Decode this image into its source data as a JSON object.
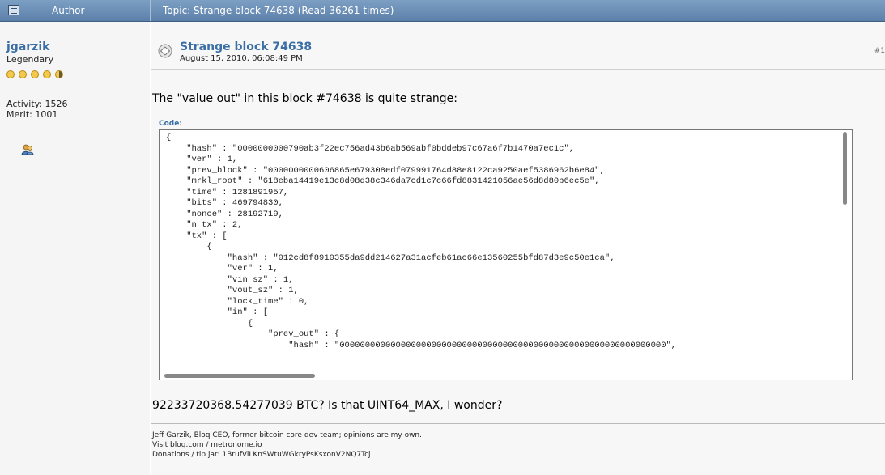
{
  "header": {
    "author_label": "Author",
    "topic_label": "Topic: Strange block 74638  (Read 36261 times)"
  },
  "poster": {
    "name": "jgarzik",
    "rank": "Legendary",
    "activity": "Activity: 1526",
    "merit": "Merit: 1001",
    "icons": {
      "rank_coins": "coin-icon",
      "profile": "user-icon"
    }
  },
  "post": {
    "title": "Strange block 74638",
    "date": "August 15, 2010, 06:08:49 PM",
    "number": "#1",
    "text_intro": "The \"value out\" in this block #74638 is quite strange:",
    "code_label": "Code:",
    "code_lines": [
      "{",
      "    \"hash\" : \"0000000000790ab3f22ec756ad43b6ab569abf0bddeb97c67a6f7b1470a7ec1c\",",
      "    \"ver\" : 1,",
      "    \"prev_block\" : \"0000000000606865e679308edf079991764d88e8122ca9250aef5386962b6e84\",",
      "    \"mrkl_root\" : \"618eba14419e13c8d08d38c346da7cd1c7c66fd8831421056ae56d8d80b6ec5e\",",
      "    \"time\" : 1281891957,",
      "    \"bits\" : 469794830,",
      "    \"nonce\" : 28192719,",
      "    \"n_tx\" : 2,",
      "    \"tx\" : [",
      "        {",
      "            \"hash\" : \"012cd8f8910355da9dd214627a31acfeb61ac66e13560255bfd87d3e9c50e1ca\",",
      "            \"ver\" : 1,",
      "            \"vin_sz\" : 1,",
      "            \"vout_sz\" : 1,",
      "            \"lock_time\" : 0,",
      "            \"in\" : [",
      "                {",
      "                    \"prev_out\" : {",
      "                        \"hash\" : \"0000000000000000000000000000000000000000000000000000000000000000\","
    ],
    "text_question": "92233720368.54277039 BTC?  Is that UINT64_MAX, I wonder?",
    "signature": [
      "Jeff Garzik, Bloq CEO, former bitcoin core dev team; opinions are my own.",
      "Visit bloq.com / metronome.io",
      "Donations / tip jar: 1BrufViLKnSWtuWGkryPsKsxonV2NQ7Tcj"
    ]
  },
  "colors": {
    "header_bg": "#6a8cb4",
    "link": "#3b6ea5"
  }
}
